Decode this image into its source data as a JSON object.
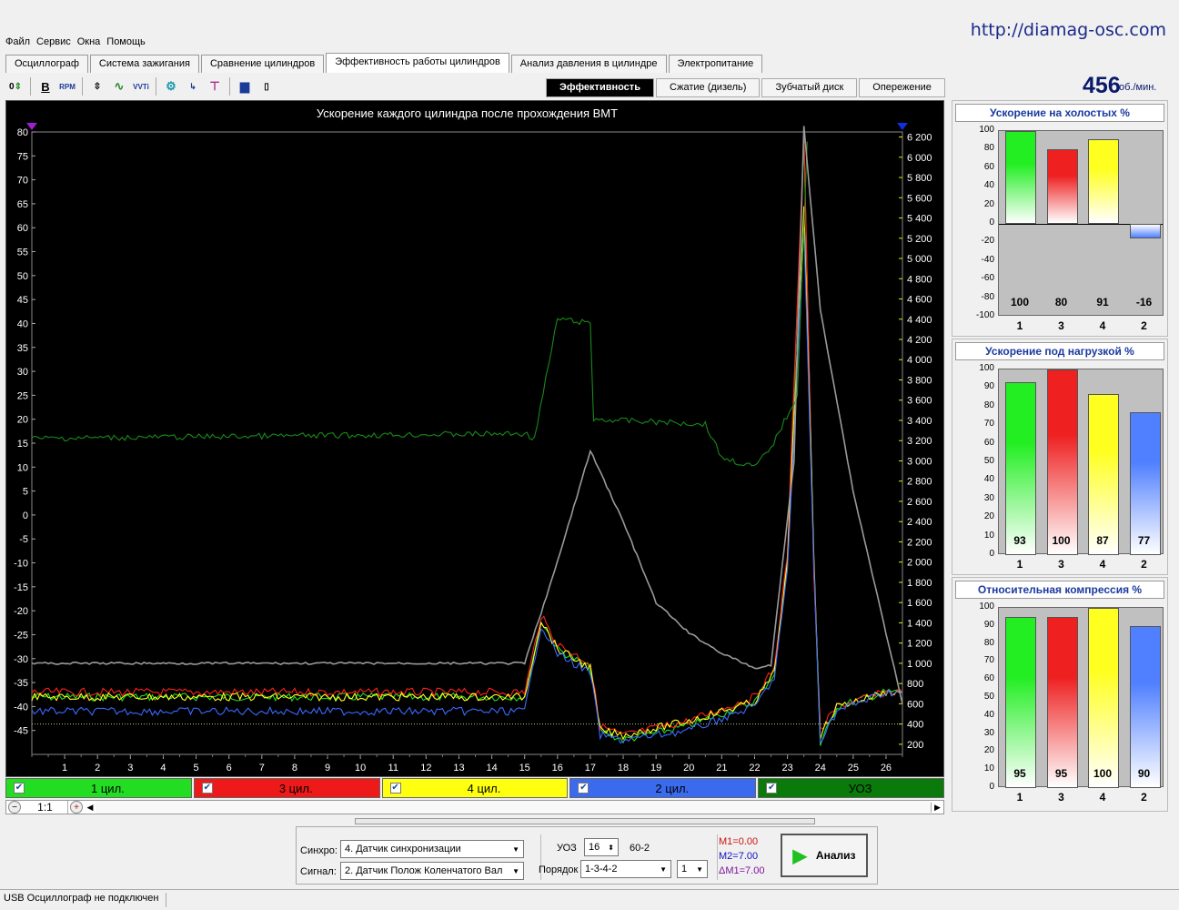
{
  "site_url": "http://diamag-osc.com",
  "menu": [
    "Файл",
    "Сервис",
    "Окна",
    "Помощь"
  ],
  "tabs": [
    {
      "label": "Осциллограф",
      "active": false
    },
    {
      "label": "Система зажигания",
      "active": false
    },
    {
      "label": "Сравнение цилиндров",
      "active": false
    },
    {
      "label": "Эффективность работы цилиндров",
      "active": true
    },
    {
      "label": "Анализ давления в цилиндре",
      "active": false
    },
    {
      "label": "Электропитание",
      "active": false
    }
  ],
  "toolbar_icons": [
    "zero-arrows-icon",
    "bold-b-icon",
    "rpm-icon",
    "scale-icon",
    "waves-icon",
    "vvti-icon",
    "cylinder-icon",
    "step-1234-icon",
    "marker-icon",
    "bars-chart-icon",
    "histogram-icon"
  ],
  "subtabs": [
    {
      "label": "Эффективность",
      "active": true
    },
    {
      "label": "Сжатие (дизель)",
      "active": false
    },
    {
      "label": "Зубчатый диск",
      "active": false
    },
    {
      "label": "Опережение",
      "active": false
    }
  ],
  "rpm": {
    "value": "456",
    "unit": "об./мин."
  },
  "chart_data": {
    "type": "line",
    "title": "Ускорение каждого цилиндра после прохождения ВМТ",
    "y_left": {
      "ticks": [
        "80",
        "75",
        "70",
        "65",
        "60",
        "55",
        "50",
        "45",
        "40",
        "35",
        "30",
        "25",
        "20",
        "15",
        "10",
        "5",
        "0",
        "-5",
        "-10",
        "-15",
        "-20",
        "-25",
        "-30",
        "-35",
        "-40",
        "-45"
      ]
    },
    "y_right": {
      "ticks": [
        "6 200",
        "6 000",
        "5 800",
        "5 600",
        "5 400",
        "5 200",
        "5 000",
        "4 800",
        "4 600",
        "4 400",
        "4 200",
        "4 000",
        "3 800",
        "3 600",
        "3 400",
        "3 200",
        "3 000",
        "2 800",
        "2 600",
        "2 400",
        "2 200",
        "2 000",
        "1 800",
        "1 600",
        "1 400",
        "1 200",
        "1 000",
        "800",
        "600",
        "400",
        "200"
      ]
    },
    "x_ticks": [
      "1",
      "2",
      "3",
      "4",
      "5",
      "6",
      "7",
      "8",
      "9",
      "10",
      "11",
      "12",
      "13",
      "14",
      "15",
      "16",
      "17",
      "18",
      "19",
      "20",
      "21",
      "22",
      "23",
      "24",
      "25",
      "26"
    ],
    "series": [
      {
        "name": "1 цил.",
        "color": "#22dd22",
        "points": [
          [
            0,
            -38
          ],
          [
            15,
            -38
          ],
          [
            15.5,
            -22
          ],
          [
            16,
            -28
          ],
          [
            17,
            -32
          ],
          [
            17.3,
            -45
          ],
          [
            18,
            -47
          ],
          [
            20,
            -44
          ],
          [
            22,
            -39
          ],
          [
            22.6,
            -33
          ],
          [
            23,
            -10
          ],
          [
            23.5,
            78
          ],
          [
            23.8,
            -10
          ],
          [
            24,
            -48
          ],
          [
            24.5,
            -40
          ],
          [
            26,
            -37
          ],
          [
            26.5,
            -37
          ]
        ]
      },
      {
        "name": "3 цил.",
        "color": "#ff2020",
        "points": [
          [
            0,
            -37
          ],
          [
            15,
            -37
          ],
          [
            15.5,
            -21
          ],
          [
            16,
            -27
          ],
          [
            17,
            -31
          ],
          [
            17.3,
            -44
          ],
          [
            18,
            -46
          ],
          [
            20,
            -43
          ],
          [
            22,
            -38
          ],
          [
            22.6,
            -32
          ],
          [
            23,
            -8
          ],
          [
            23.5,
            80
          ],
          [
            23.8,
            -12
          ],
          [
            24,
            -45
          ],
          [
            24.5,
            -40
          ],
          [
            26,
            -37
          ],
          [
            26.5,
            -37
          ]
        ]
      },
      {
        "name": "4 цил.",
        "color": "#ffff20",
        "points": [
          [
            0,
            -38
          ],
          [
            15,
            -38
          ],
          [
            15.5,
            -22
          ],
          [
            16,
            -28
          ],
          [
            17,
            -32
          ],
          [
            17.3,
            -45
          ],
          [
            18,
            -46
          ],
          [
            20,
            -43
          ],
          [
            22,
            -39
          ],
          [
            22.6,
            -33
          ],
          [
            23,
            -10
          ],
          [
            23.5,
            65
          ],
          [
            23.8,
            -8
          ],
          [
            24,
            -46
          ],
          [
            24.5,
            -40
          ],
          [
            26,
            -37
          ],
          [
            26.5,
            -37
          ]
        ]
      },
      {
        "name": "2 цил.",
        "color": "#3a6aff",
        "points": [
          [
            0,
            -41
          ],
          [
            15,
            -41
          ],
          [
            15.5,
            -23
          ],
          [
            16,
            -29
          ],
          [
            17,
            -33
          ],
          [
            17.3,
            -46
          ],
          [
            18,
            -47
          ],
          [
            20,
            -45
          ],
          [
            22,
            -40
          ],
          [
            22.6,
            -34
          ],
          [
            23,
            -12
          ],
          [
            23.5,
            60
          ],
          [
            23.8,
            -10
          ],
          [
            24,
            -47
          ],
          [
            24.5,
            -41
          ],
          [
            26,
            -37
          ],
          [
            26.5,
            -37
          ]
        ]
      },
      {
        "name": "УОЗ",
        "color": "#1a8a1a",
        "points": [
          [
            0,
            16
          ],
          [
            15,
            17
          ],
          [
            15.3,
            16
          ],
          [
            16,
            41
          ],
          [
            17,
            40
          ],
          [
            17.1,
            20
          ],
          [
            20.5,
            19
          ],
          [
            21,
            12
          ],
          [
            22,
            10
          ],
          [
            22.5,
            14
          ],
          [
            23.3,
            25
          ],
          [
            23.6,
            78
          ]
        ]
      },
      {
        "name": "RPM",
        "color": "#9a9a9a",
        "axis": "right",
        "points": [
          [
            0,
            1000
          ],
          [
            15,
            1000
          ],
          [
            16,
            2000
          ],
          [
            17,
            3100
          ],
          [
            18,
            2400
          ],
          [
            19,
            1600
          ],
          [
            20,
            1300
          ],
          [
            21,
            1100
          ],
          [
            22,
            950
          ],
          [
            22.5,
            980
          ],
          [
            23.2,
            3000
          ],
          [
            23.5,
            6300
          ],
          [
            24,
            4500
          ],
          [
            25,
            2700
          ],
          [
            26.5,
            600
          ]
        ]
      }
    ],
    "ylim": [
      -50,
      80
    ],
    "y2lim": [
      100,
      6250
    ],
    "xlim": [
      0,
      26.5
    ]
  },
  "legend": [
    {
      "label": "1 цил.",
      "color": "#22dd22",
      "checked": true
    },
    {
      "label": "3 цил.",
      "color": "#ee1a1a",
      "checked": true
    },
    {
      "label": "4 цил.",
      "color": "#ffff10",
      "checked": true
    },
    {
      "label": "2 цил.",
      "color": "#3a6aee",
      "checked": true
    },
    {
      "label": "УОЗ",
      "color": "#0a7a0a",
      "checked": true
    }
  ],
  "zoom": "1:1",
  "controls": {
    "sync_label": "Синхро:",
    "sync_value": "4.  Датчик синхронизации",
    "signal_label": "Сигнал:",
    "signal_value": "2.  Датчик Полож Коленчатого Вал",
    "uoz_label": "УОЗ",
    "uoz_value": "16",
    "teeth": "60-2",
    "order_label": "Порядок",
    "order_value": "1-3-4-2",
    "order_start": "1",
    "m1": "M1=0.00",
    "m2": "M2=7.00",
    "dm": "ΔM1=7.00",
    "analyze": "Анализ"
  },
  "status": "USB Осциллограф не подключен",
  "panels": [
    {
      "title": "Ускорение на холостых %",
      "ymin": -100,
      "ymax": 100,
      "yticks": [
        "100",
        "80",
        "60",
        "40",
        "20",
        "0",
        "-20",
        "-40",
        "-60",
        "-80",
        "-100"
      ],
      "bars": [
        {
          "cyl": "1",
          "value": 100,
          "color": "#22ee22"
        },
        {
          "cyl": "3",
          "value": 80,
          "color": "#ee2020"
        },
        {
          "cyl": "4",
          "value": 91,
          "color": "#ffff20"
        },
        {
          "cyl": "2",
          "value": -16,
          "color": "#5080ff"
        }
      ],
      "labels": [
        "100",
        "80",
        "91",
        "-16"
      ]
    },
    {
      "title": "Ускорение под нагрузкой %",
      "ymin": 0,
      "ymax": 100,
      "yticks": [
        "100",
        "90",
        "80",
        "70",
        "60",
        "50",
        "40",
        "30",
        "20",
        "10",
        "0"
      ],
      "bars": [
        {
          "cyl": "1",
          "value": 93,
          "color": "#22ee22"
        },
        {
          "cyl": "3",
          "value": 100,
          "color": "#ee2020"
        },
        {
          "cyl": "4",
          "value": 87,
          "color": "#ffff20"
        },
        {
          "cyl": "2",
          "value": 77,
          "color": "#5080ff"
        }
      ],
      "labels": [
        "93",
        "100",
        "87",
        "77"
      ]
    },
    {
      "title": "Относительная компрессия %",
      "ymin": 0,
      "ymax": 100,
      "yticks": [
        "100",
        "90",
        "80",
        "70",
        "60",
        "50",
        "40",
        "30",
        "20",
        "10",
        "0"
      ],
      "bars": [
        {
          "cyl": "1",
          "value": 95,
          "color": "#22ee22"
        },
        {
          "cyl": "3",
          "value": 95,
          "color": "#ee2020"
        },
        {
          "cyl": "4",
          "value": 100,
          "color": "#ffff20"
        },
        {
          "cyl": "2",
          "value": 90,
          "color": "#5080ff"
        }
      ],
      "labels": [
        "95",
        "95",
        "100",
        "90"
      ]
    }
  ]
}
